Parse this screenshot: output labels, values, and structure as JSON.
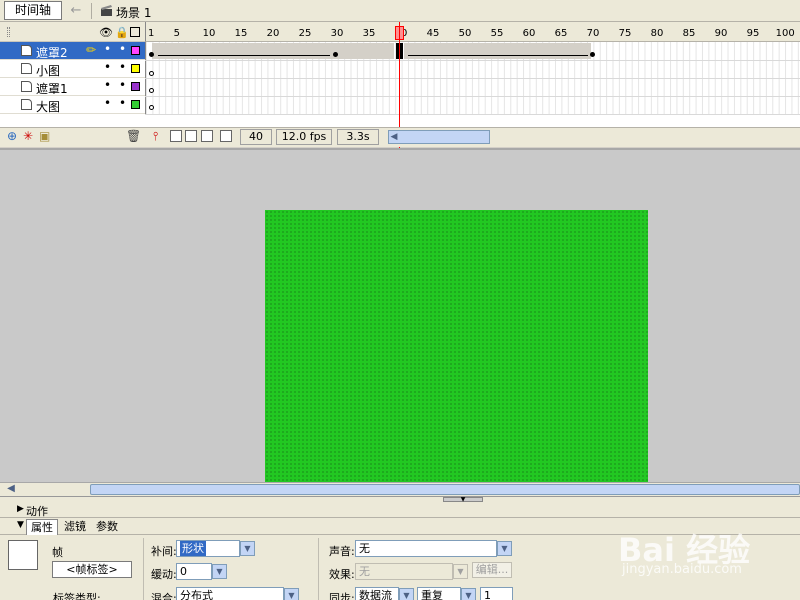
{
  "topbar": {
    "tab_label": "时间轴",
    "back_icon": "back-arrow-icon",
    "scene_label": "场景 1"
  },
  "layers": [
    {
      "name": "遮罩2",
      "selected": true,
      "color": "#ff44ff"
    },
    {
      "name": "小图",
      "selected": false,
      "color": "#ffff00"
    },
    {
      "name": "遮罩1",
      "selected": false,
      "color": "#9933cc"
    },
    {
      "name": "大图",
      "selected": false,
      "color": "#33cc33"
    }
  ],
  "dot": "•",
  "ruler": {
    "ticks": [
      "1",
      "5",
      "10",
      "15",
      "20",
      "25",
      "30",
      "35",
      "40",
      "45",
      "50",
      "55",
      "60",
      "65",
      "70",
      "75",
      "80",
      "85",
      "90",
      "95",
      "100"
    ]
  },
  "status": {
    "frame": "40",
    "fps": "12.0 fps",
    "time": "3.3s"
  },
  "panels": {
    "actions_label": "动作",
    "tabs": [
      "属性",
      "滤镜",
      "参数"
    ],
    "frame_label": "帧",
    "frame_name_placeholder": "<帧标签>",
    "label_type": "标签类型:",
    "tween_label": "补间:",
    "tween_value": "形状",
    "ease_label": "缓动:",
    "ease_value": "0",
    "blend_label": "混合:",
    "blend_value": "分布式",
    "sound_label": "声音:",
    "sound_value": "无",
    "effect_label": "效果:",
    "effect_value": "无",
    "edit_label": "编辑...",
    "sync_label": "同步:",
    "sync_value": "数据流",
    "repeat_value": "重复",
    "repeat_count": "1"
  },
  "watermark": {
    "text": "Bai 经验",
    "sub": "jingyan.baidu.com"
  }
}
